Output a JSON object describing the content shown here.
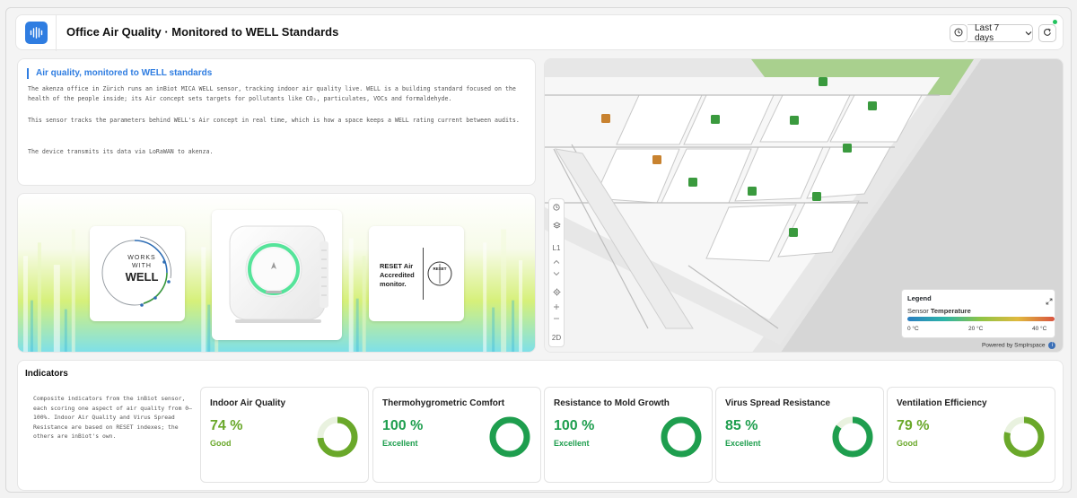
{
  "header": {
    "logo_icon": "sensor-waveform-icon",
    "title": "Office Air Quality · Monitored to WELL Standards",
    "time_range": "Last 7 days",
    "clock_icon": "clock-icon",
    "refresh_icon": "refresh-icon"
  },
  "info": {
    "heading": "Air quality, monitored to WELL standards",
    "paragraph_1": "The akenza office in Zürich runs an inBiot MICA WELL sensor, tracking indoor air quality live. WELL is a building standard focused on the health of the people inside; its Air concept sets targets for pollutants like CO₂, particulates, VOCs and formaldehyde.",
    "paragraph_2": "This sensor tracks the parameters behind WELL's Air concept in real time, which is how a space keeps a WELL rating current between audits.",
    "paragraph_3": "The device transmits its data via LoRaWAN to akenza."
  },
  "banner": {
    "works_with_well": [
      "WORKS",
      "WITH",
      "WELL"
    ],
    "reset_lines": [
      "RESET Air",
      "Accredited",
      "monitor."
    ],
    "reset_logo": "RESET"
  },
  "map": {
    "toolbar": {
      "level": "L1",
      "view_mode": "2D"
    },
    "legend": {
      "title": "Legend",
      "sensor_prefix": "Sensor",
      "sensor_metric": "Temperature",
      "min": "0 °C",
      "mid": "20 °C",
      "max": "40 °C"
    },
    "powered_by": "Powered by Smplrspace",
    "colors": {
      "sensor_green": "#3a9a3e",
      "sensor_orange": "#c8822f",
      "lawn": "#a9d08e"
    }
  },
  "indicators": {
    "title": "Indicators",
    "description": "Composite indicators from the inBiot sensor, each scoring one aspect of air quality from 0–100%. Indoor Air Quality and Virus Spread Resistance are based on RESET indexes; the others are inBiot's own.",
    "items": [
      {
        "name": "Indoor Air Quality",
        "value": "74 %",
        "percent": 74,
        "status": "Good",
        "color": "#6aa82a"
      },
      {
        "name": "Thermohygrometric Comfort",
        "value": "100 %",
        "percent": 100,
        "status": "Excellent",
        "color": "#1e9e4e"
      },
      {
        "name": "Resistance to Mold Growth",
        "value": "100 %",
        "percent": 100,
        "status": "Excellent",
        "color": "#1e9e4e"
      },
      {
        "name": "Virus Spread Resistance",
        "value": "85 %",
        "percent": 85,
        "status": "Excellent",
        "color": "#1e9e4e"
      },
      {
        "name": "Ventilation Efficiency",
        "value": "79 %",
        "percent": 79,
        "status": "Good",
        "color": "#6aa82a"
      }
    ]
  }
}
